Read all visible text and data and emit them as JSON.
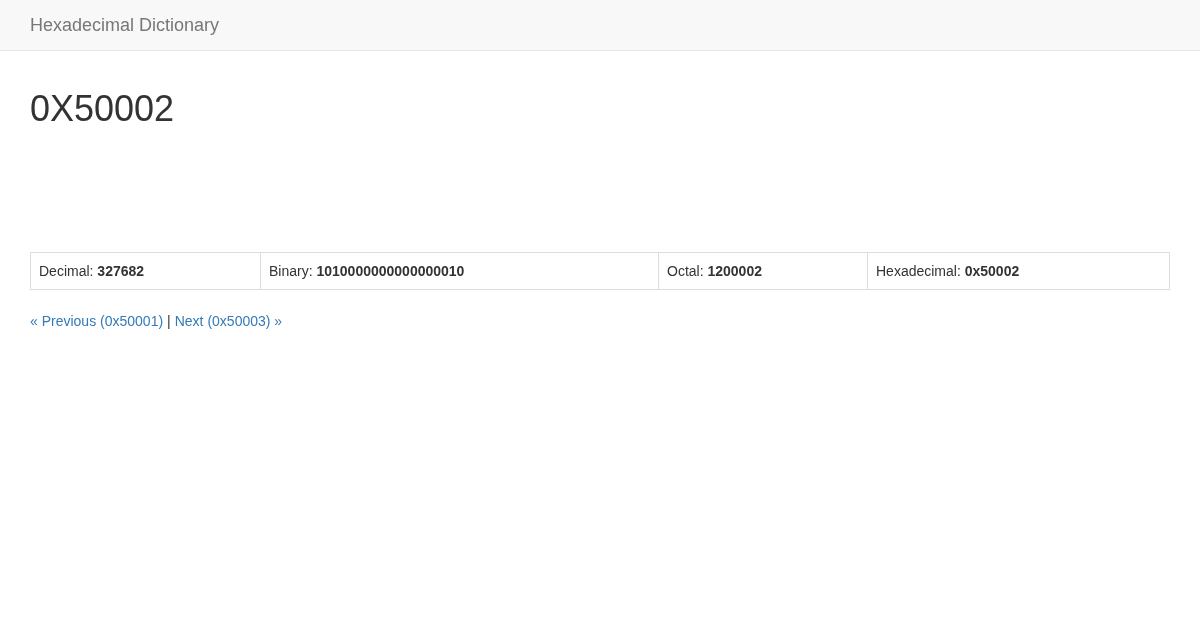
{
  "navbar": {
    "brand": "Hexadecimal Dictionary"
  },
  "heading": "0X50002",
  "table": {
    "cells": [
      "Decimal: **327682**",
      "Binary: **1010000000000000010**",
      "Octal: **1200002**",
      "Hexadecimal: **0x50002**"
    ]
  },
  "pager": {
    "previous": "« Previous (0x50001)",
    "separator": "|",
    "next": "Next (0x50003) »"
  }
}
